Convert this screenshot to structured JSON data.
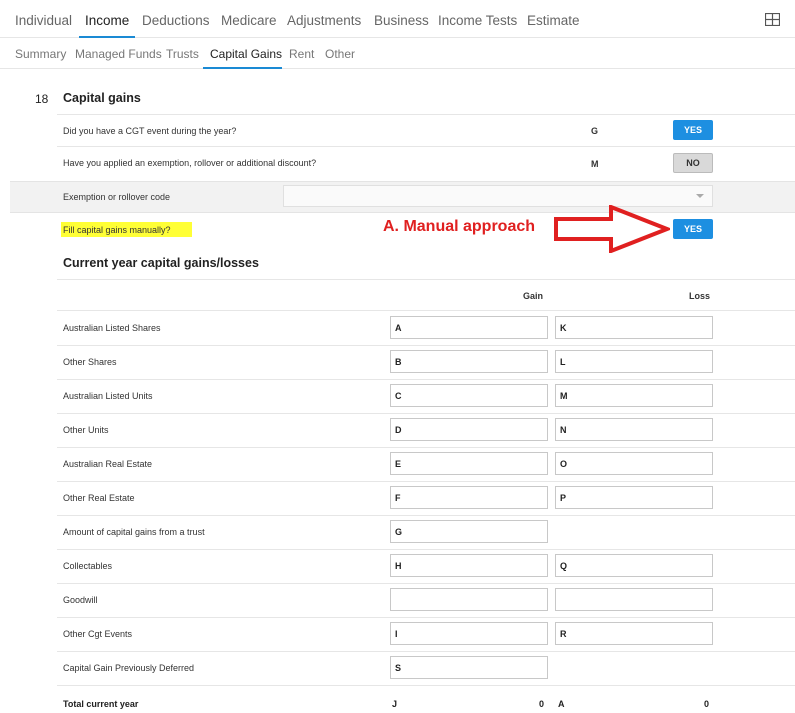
{
  "top_tabs": [
    "Individual",
    "Income",
    "Deductions",
    "Medicare",
    "Adjustments",
    "Business",
    "Income Tests",
    "Estimate"
  ],
  "sub_tabs": [
    "Summary",
    "Managed Funds",
    "Trusts",
    "Capital Gains",
    "Rent",
    "Other"
  ],
  "section": {
    "number": "18",
    "title": "Capital gains"
  },
  "questions": {
    "cgt_event": {
      "label": "Did you have a CGT event during the year?",
      "letter": "G",
      "button": "YES"
    },
    "exemption": {
      "label": "Have you applied an exemption, rollover or additional discount?",
      "letter": "M",
      "button": "NO"
    },
    "exemption_code": {
      "label": "Exemption or rollover code",
      "value": ""
    },
    "manual": {
      "label": "Fill capital gains manually?",
      "button": "YES"
    }
  },
  "annotation": {
    "text": "A. Manual approach",
    "color": "#e02020"
  },
  "current_year": {
    "title": "Current year capital gains/losses",
    "gain_header": "Gain",
    "loss_header": "Loss",
    "rows": [
      {
        "label": "Australian Listed Shares",
        "gain": "A",
        "loss": "K"
      },
      {
        "label": "Other Shares",
        "gain": "B",
        "loss": "L"
      },
      {
        "label": "Australian Listed Units",
        "gain": "C",
        "loss": "M"
      },
      {
        "label": "Other Units",
        "gain": "D",
        "loss": "N"
      },
      {
        "label": "Australian Real Estate",
        "gain": "E",
        "loss": "O"
      },
      {
        "label": "Other Real Estate",
        "gain": "F",
        "loss": "P"
      },
      {
        "label": "Amount of capital gains from a trust",
        "gain": "G",
        "loss": null
      },
      {
        "label": "Collectables",
        "gain": "H",
        "loss": "Q"
      },
      {
        "label": "Goodwill",
        "gain": "",
        "loss": ""
      },
      {
        "label": "Other Cgt Events",
        "gain": "I",
        "loss": "R"
      },
      {
        "label": "Capital Gain Previously Deferred",
        "gain": "S",
        "loss": null
      }
    ],
    "total": {
      "label": "Total current year",
      "gain_letter": "J",
      "gain_value": "0",
      "loss_letter": "A",
      "loss_value": "0"
    }
  },
  "colors": {
    "accent": "#1a8ad4",
    "button_yes": "#1d8fe1",
    "highlight": "#ffff36",
    "annotation": "#e02020"
  }
}
